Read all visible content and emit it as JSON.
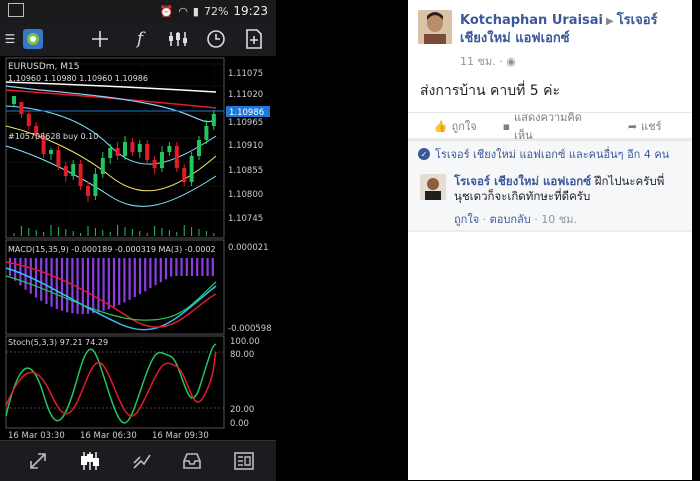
{
  "status_bar": {
    "battery": "72%",
    "time": "19:23"
  },
  "toolbar": {
    "icons": [
      "metaquotes-logo-icon",
      "crosshair-icon",
      "function-icon",
      "indicators-icon",
      "clock-icon",
      "add-object-icon"
    ],
    "function_glyph": "f"
  },
  "chart": {
    "symbol": "EURUSDm, M15",
    "ohlc": "1.10960 1.10980 1.10960 1.10986",
    "order_label": "#105708628 buy 0.10",
    "current_price": "1.10986",
    "price_labels": [
      "1.11075",
      "1.11020",
      "1.10965",
      "1.10910",
      "1.10855",
      "1.10800",
      "1.10745"
    ],
    "macd_label": "MACD(15,35,9) -0.000189 -0.000319 MA(3) -0.0002",
    "macd_max": "0.000021",
    "macd_min": "-0.000598",
    "stoch_label": "Stoch(5,3,3) 97.21 74.29",
    "stoch_levels": [
      "100.00",
      "80.00",
      "20.00",
      "0.00"
    ],
    "time_labels": [
      "16 Mar 03:30",
      "16 Mar 06:30",
      "16 Mar 09:30"
    ],
    "colors": {
      "up": "#22c55e",
      "down": "#e11d2a",
      "macd_hist": "#8b3ee6",
      "signal": "#e11d2a",
      "macd_line": "#38bdf8"
    }
  },
  "bottom_bar": {
    "icons": [
      "trade-icon",
      "candles-icon",
      "chart-line-icon",
      "inbox-icon",
      "news-icon"
    ]
  },
  "facebook": {
    "post": {
      "author": "Kotchaphan Uraisai",
      "target": "โรเจอร์ เชียงใหม่ แอฟเอกซ์",
      "time": "11 ชม.",
      "content": "ส่งการบ้าน คาบที่ 5 ค่ะ",
      "actions": [
        "ถูกใจ",
        "แสดงความคิดเห็น",
        "แชร์"
      ]
    },
    "likes_text": "โรเจอร์ เชียงใหม่ แอฟเอกซ์ และคนอื่นๆ อีก 4 คน",
    "comment": {
      "author": "โรเจอร์ เชียงใหม่ แอฟเอกซ์",
      "text": "ฝึกไปนะครับพี่ นุชเดวก็จะเกิดทักษะที่ดีครับ",
      "like": "ถูกใจ",
      "reply": "ตอบกลับ",
      "time": "10 ชม."
    }
  }
}
